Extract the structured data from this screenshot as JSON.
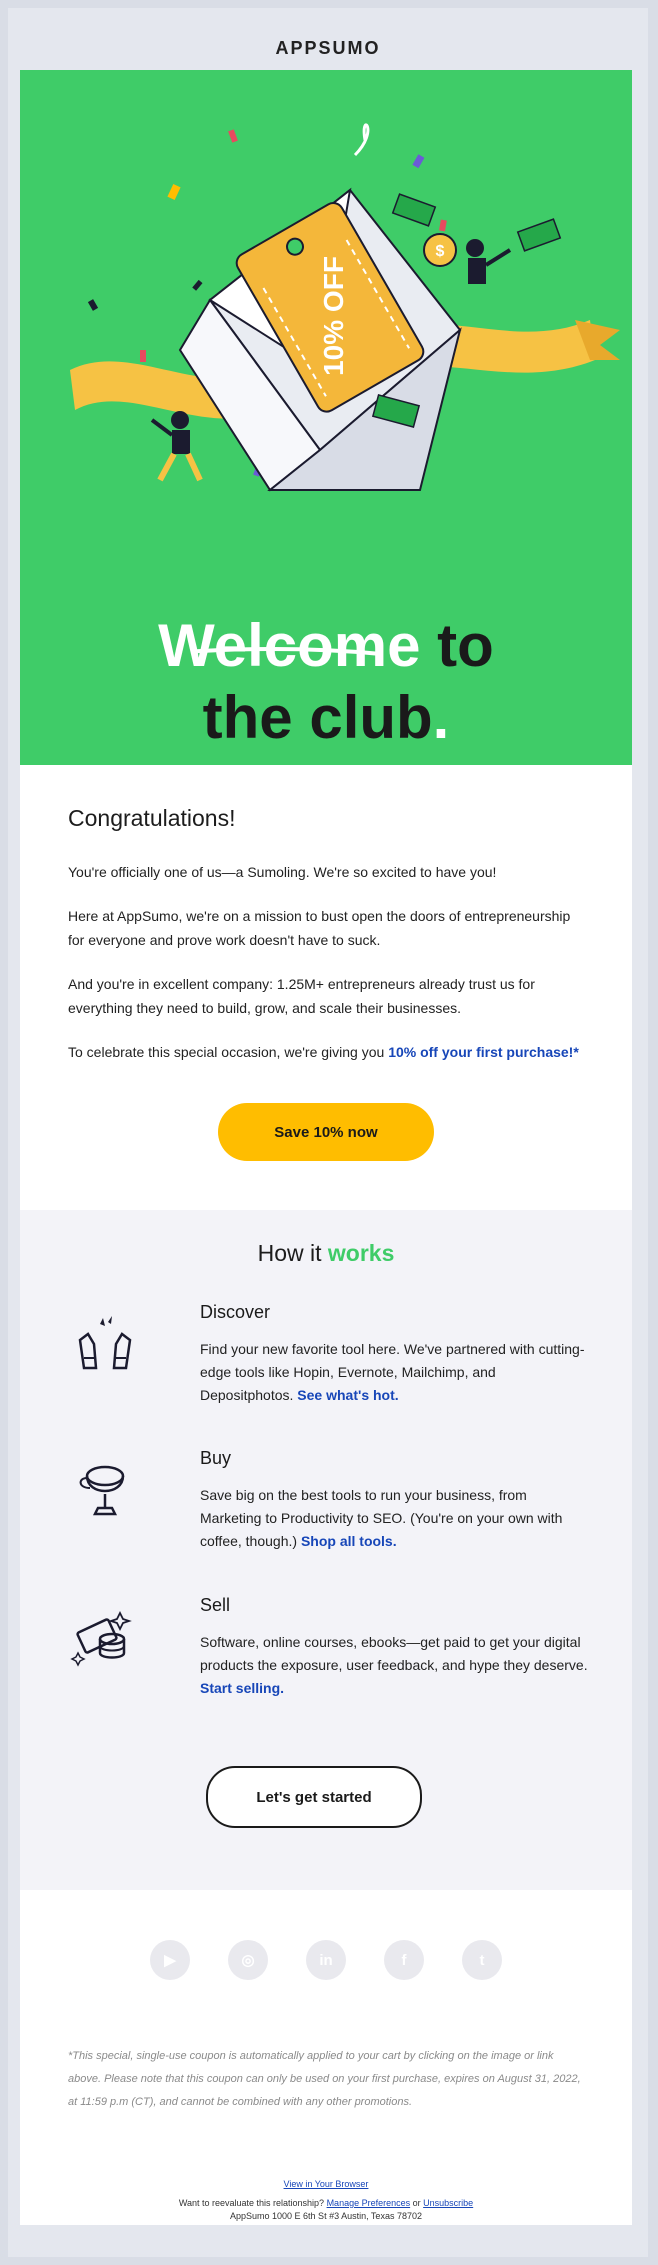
{
  "brand": {
    "logo": "APPSUMO"
  },
  "hero": {
    "coupon_text": "10% OFF",
    "headline_word1": "Welcome",
    "headline_word2": " to",
    "headline_line2": "the club",
    "headline_dot": "."
  },
  "intro": {
    "title": "Congratulations!",
    "p1": "You're officially one of us—a Sumoling. We're so excited to have you!",
    "p2": "Here at AppSumo, we're on a mission to bust open the doors of entrepreneurship for everyone and prove work doesn't have to suck.",
    "p3": "And you're in excellent company: 1.25M+ entrepreneurs already trust us for everything they need to build, grow, and scale their businesses.",
    "p4_prefix": "To celebrate this special occasion, we're giving you ",
    "p4_link": "10% off your first purchase!*",
    "cta": "Save 10% now"
  },
  "how": {
    "title_part1": "How it ",
    "title_part2": "works",
    "features": [
      {
        "title": "Discover",
        "text": "Find your new favorite tool here. We've partnered with cutting-edge tools like Hopin, Evernote, Mailchimp, and Depositphotos. ",
        "link": "See what's hot.",
        "icon": "hands-sparkle-icon"
      },
      {
        "title": "Buy",
        "text": "Save big on the best tools to run your business, from Marketing to Productivity to SEO. (You're on your own with coffee, though.) ",
        "link": "Shop all tools.",
        "icon": "trophy-icon"
      },
      {
        "title": "Sell",
        "text": "Software, online courses, ebooks—get paid to get your digital products the exposure, user feedback, and hype they deserve. ",
        "link": "Start selling.",
        "icon": "money-coins-icon"
      }
    ],
    "cta": "Let's get started"
  },
  "social": {
    "icons": [
      "youtube-icon",
      "instagram-icon",
      "linkedin-icon",
      "facebook-icon",
      "twitter-icon"
    ],
    "glyphs": [
      "▶",
      "◎",
      "in",
      "f",
      "t"
    ]
  },
  "disclaimer": "*This special, single-use coupon is automatically applied to your cart by clicking on the image or link above. Please note that this coupon can only be used on your first purchase, expires on August 31, 2022, at 11:59 p.m (CT), and cannot be combined with any other promotions.",
  "footer": {
    "view_browser": "View in Your Browser",
    "line2_prefix": "Want to reevaluate this relationship? ",
    "manage": "Manage Preferences",
    "or": " or ",
    "unsubscribe": "Unsubscribe",
    "address": "AppSumo 1000 E 6th St #3 Austin, Texas 78702"
  },
  "colors": {
    "hero_green": "#3fcc68",
    "cta_yellow": "#ffbd00",
    "link_blue": "#1746b8",
    "section_bg": "#f3f3f8"
  }
}
